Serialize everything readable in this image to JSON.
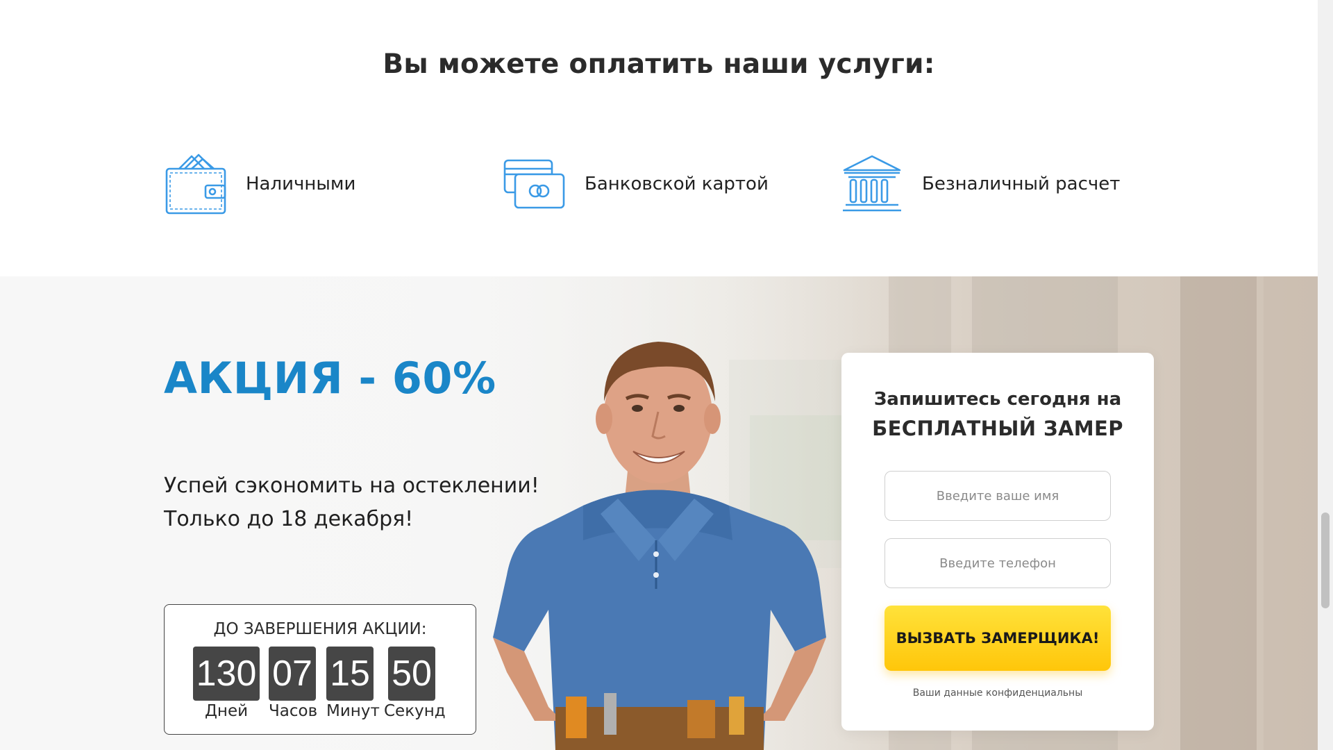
{
  "payment": {
    "title": "Вы можете оплатить наши услуги:",
    "methods": [
      {
        "label": "Наличными",
        "icon": "wallet-icon"
      },
      {
        "label": "Банковской картой",
        "icon": "credit-card-icon"
      },
      {
        "label": "Безналичный расчет",
        "icon": "bank-icon"
      }
    ]
  },
  "promo": {
    "title": "АКЦИЯ - 60%",
    "text_line1": "Успей сэкономить на остеклении!",
    "text_line2": "Только до 18 декабря!",
    "countdown": {
      "title": "ДО ЗАВЕРШЕНИЯ АКЦИИ:",
      "units": [
        {
          "value": "130",
          "label": "Дней"
        },
        {
          "value": "07",
          "label": "Часов"
        },
        {
          "value": "15",
          "label": "Минут"
        },
        {
          "value": "50",
          "label": "Секунд"
        }
      ]
    }
  },
  "form": {
    "subtitle": "Запишитесь сегодня на",
    "title": "БЕСПЛАТНЫЙ ЗАМЕР",
    "name_placeholder": "Введите ваше имя",
    "phone_placeholder": "Введите телефон",
    "button_label": "ВЫЗВАТЬ ЗАМЕРЩИКА!",
    "note": "Ваши данные конфиденциальны"
  },
  "colors": {
    "accent": "#1a86c8",
    "icon_blue": "#3a9ae6",
    "button_yellow": "#ffc60a",
    "counter_bg": "#464646"
  }
}
